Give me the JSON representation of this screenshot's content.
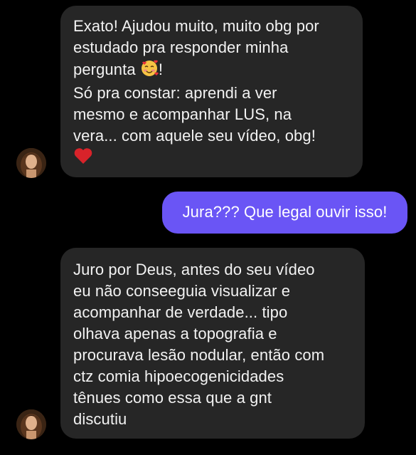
{
  "colors": {
    "background": "#000000",
    "incoming_bubble": "#262626",
    "outgoing_bubble": "#6a55f5",
    "text": "#f2f2f2"
  },
  "messages": [
    {
      "direction": "incoming",
      "lines": [
        "Exato! Ajudou muito, muito obg por",
        "estudado pra responder minha",
        "pergunta",
        "Só pra constar: aprendi a ver",
        "mesmo e acompanhar LUS, na",
        "vera... com aquele seu vídeo, obg!"
      ],
      "emoji_after_line_3": "smiling-face-with-hearts-icon",
      "trailing_emoji": "red-heart-icon",
      "line3_suffix": "!"
    },
    {
      "direction": "outgoing",
      "lines": [
        "Jura??? Que legal ouvir isso!"
      ]
    },
    {
      "direction": "incoming",
      "lines": [
        "Juro por Deus, antes do seu vídeo",
        "eu não conseeguia visualizar e",
        "acompanhar de verdade... tipo",
        "olhava apenas a topografia e",
        "procurava lesão nodular, então com",
        "ctz comia hipoecogenicidades",
        "tênues como essa que a gnt",
        "discutiu"
      ]
    }
  ]
}
